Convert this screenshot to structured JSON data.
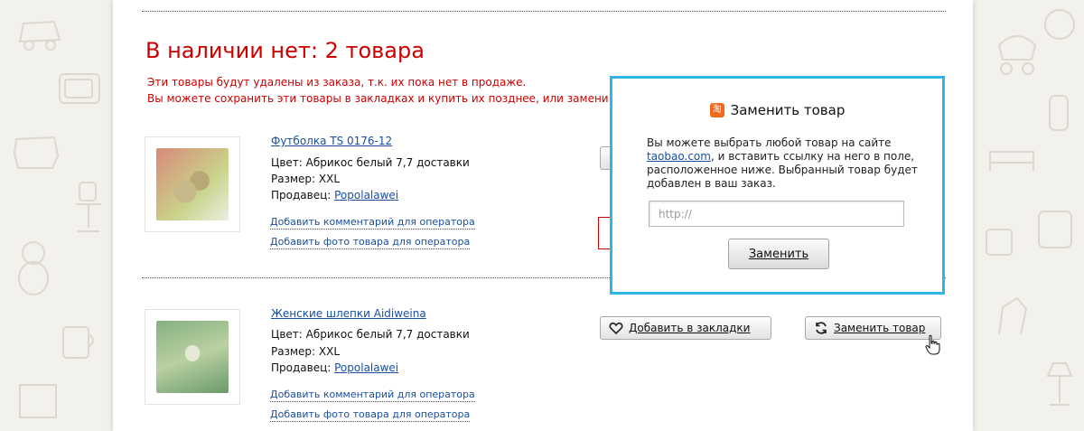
{
  "section": {
    "title": "В наличии нет: 2 товара",
    "note_line1": "Эти товары будут удалены из заказа, т.к. их пока нет в продаже.",
    "note_line2": "Вы можете сохранить эти товары в закладках и купить их позднее, или замени"
  },
  "items": [
    {
      "name": "Футболка TS 0176-12",
      "color": "Цвет: Абрикос белый 7,7 доставки",
      "size": "Размер: XXL",
      "seller_label": "Продавец: ",
      "seller": "Popolalawei",
      "comment_link": "Добавить комментарий для оператора",
      "photo_link": "Добавить фото товара для оператора"
    },
    {
      "name": "Женские шлепки Aidiweina ",
      "color": "Цвет: Абрикос белый 7,7 доставки",
      "size": "Размер: XXL",
      "seller_label": "Продавец: ",
      "seller": "Popolalawei",
      "comment_link": "Добавить комментарий для оператора",
      "photo_link": "Добавить фото товара для оператора",
      "bookmark_button": "Добавить в закладки",
      "replace_button": "Заменить товар"
    }
  ],
  "popup": {
    "title": "Заменить товар",
    "icon_glyph": "淘",
    "text_before": "Вы можете выбрать любой товар на сайте ",
    "link": "taobao.com",
    "text_after": ", и вставить ссылку на него в поле, расположенное ниже. Выбранный товар будет добавлен в ваш заказ.",
    "input_placeholder": "http://",
    "button": "Заменить"
  },
  "colors": {
    "accent_red": "#cc0000",
    "link_blue": "#1a4fa0",
    "popup_border": "#2fb6e8",
    "taobao_orange": "#ef6a1d"
  }
}
